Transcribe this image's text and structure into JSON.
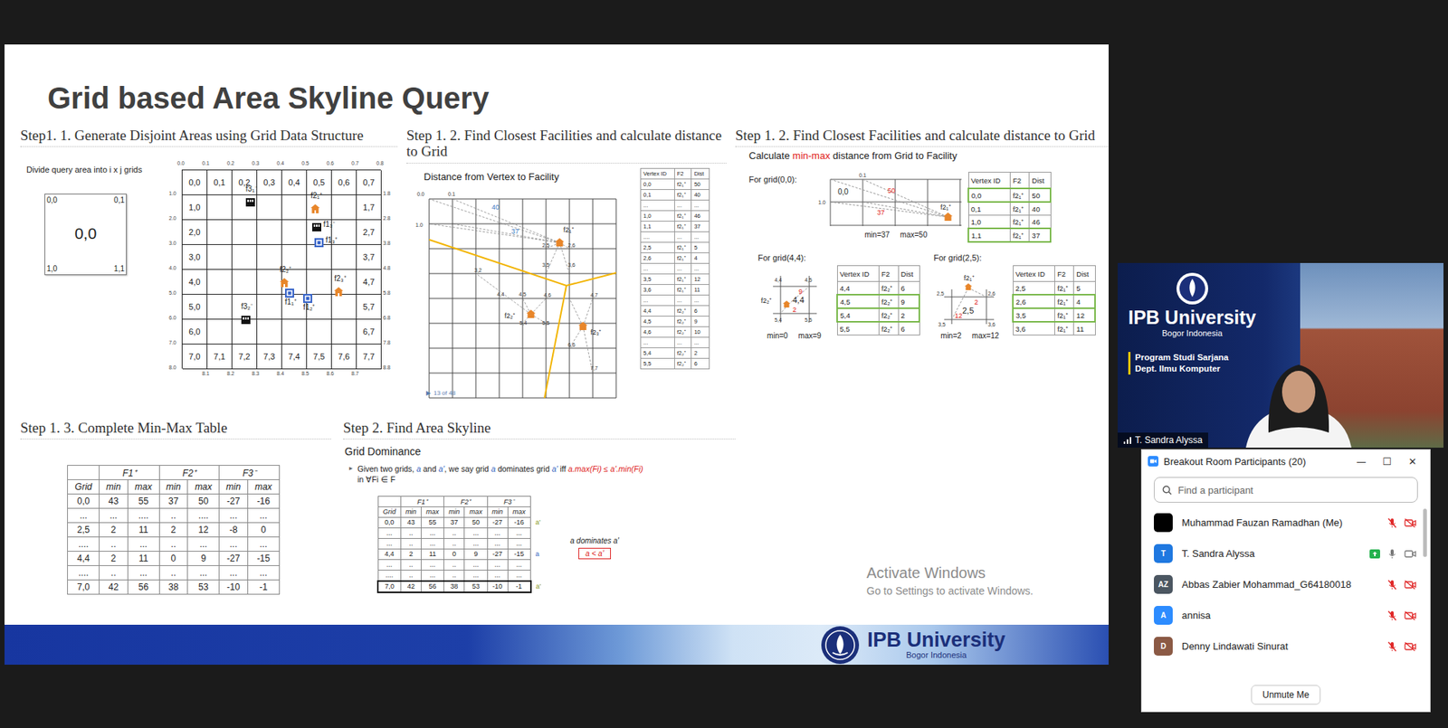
{
  "slide": {
    "title": "Grid based Area Skyline Query",
    "step_generate": {
      "heading": "Step1. 1. Generate Disjoint Areas using Grid Data Structure",
      "caption": "Divide query area into i x j grids",
      "sample_cell": {
        "corners": [
          "0,0",
          "0,1",
          "1,0",
          "1,1"
        ],
        "label": "0,0"
      },
      "grid_rows": [
        [
          "0,0",
          "0,1",
          "0,2",
          "0,3",
          "0,4",
          "0,5",
          "0,6",
          "0,7"
        ],
        [
          "1,0",
          "",
          "",
          "",
          "",
          "",
          "",
          "1,7"
        ],
        [
          "2,0",
          "",
          "",
          "",
          "",
          "",
          "",
          "2,7"
        ],
        [
          "3,0",
          "",
          "",
          "",
          "",
          "",
          "",
          "3,7"
        ],
        [
          "4,0",
          "",
          "",
          "",
          "",
          "",
          "",
          "4,7"
        ],
        [
          "5,0",
          "",
          "",
          "",
          "",
          "",
          "",
          "5,7"
        ],
        [
          "6,0",
          "",
          "",
          "",
          "",
          "",
          "",
          "6,7"
        ],
        [
          "7,0",
          "7,1",
          "7,2",
          "7,3",
          "7,4",
          "7,5",
          "7,6",
          "7,7"
        ]
      ],
      "axis_top": [
        "0.0",
        "0.1",
        "0.2",
        "0.3",
        "0.4",
        "0.5",
        "0.6",
        "0.7",
        "0.8"
      ],
      "axis_left": [
        "1.0",
        "2.0",
        "3.0",
        "4.0",
        "5.0",
        "6.0",
        "7.0",
        "8.0"
      ],
      "axis_right": [
        "1.8",
        "2.8",
        "3.8",
        "4.8",
        "5.8",
        "6.8",
        "7.8",
        "8.8"
      ],
      "axis_bottom": [
        "8.1",
        "8.2",
        "8.3",
        "8.4",
        "8.5",
        "8.6",
        "8.7"
      ],
      "facilities": [
        {
          "label": "f3₁⁻",
          "kind": "hotel"
        },
        {
          "label": "f2₁⁺",
          "kind": "house"
        },
        {
          "label": "f1₃⁻",
          "kind": "hotel"
        },
        {
          "label": "f1₃⁺",
          "kind": "square"
        },
        {
          "label": "f2₂⁺",
          "kind": "house"
        },
        {
          "label": "f2₃⁺",
          "kind": "house"
        },
        {
          "label": "f1₁⁺",
          "kind": "square"
        },
        {
          "label": "f1₂⁺",
          "kind": "square"
        },
        {
          "label": "f3₂⁻",
          "kind": "hotel"
        }
      ]
    },
    "step_distance": {
      "heading": "Step 1. 2. Find Closest Facilities and calculate distance to Grid",
      "subtitle": "Distance from Vertex to Facility",
      "axis_labels": [
        "0.0",
        "0.1",
        "1.0"
      ],
      "distance_labels": [
        "40",
        "37"
      ],
      "vertex_labels": [
        "3,2",
        "2,5",
        "2,6",
        "3,5",
        "3,6",
        "4,4",
        "4,5",
        "4,6",
        "4,7",
        "5,4",
        "5,5",
        "6,6",
        "7,7"
      ],
      "facilities": [
        "f2₁⁺",
        "f2₂⁺",
        "f2₃⁺"
      ],
      "pager_icon": "▶",
      "pager": "13 of 48",
      "table": {
        "columns": [
          "Vertex ID",
          "F2",
          "Dist"
        ],
        "rows": [
          [
            "0,0",
            "f2₁⁺",
            "50"
          ],
          [
            "0,1",
            "f2₁⁺",
            "40"
          ],
          [
            "...",
            "...",
            "..."
          ],
          [
            "1,0",
            "f2₁⁺",
            "46"
          ],
          [
            "1,1",
            "f2₁⁺",
            "37"
          ],
          [
            "....",
            "...",
            "..."
          ],
          [
            "2,5",
            "f2₁⁺",
            "5"
          ],
          [
            "2,6",
            "f2₁⁺",
            "4"
          ],
          [
            "...",
            "...",
            "..."
          ],
          [
            "3,5",
            "f2₁⁺",
            "12"
          ],
          [
            "3,6",
            "f2₁⁺",
            "11"
          ],
          [
            "...",
            "...",
            "..."
          ],
          [
            "4,4",
            "f2₂⁺",
            "6"
          ],
          [
            "4,5",
            "f2₂⁺",
            "9"
          ],
          [
            "4,6",
            "f2₂⁺",
            "10"
          ],
          [
            "...",
            "...",
            "..."
          ],
          [
            "5,4",
            "f2₂⁺",
            "2"
          ],
          [
            "5,5",
            "f2₂⁺",
            "6"
          ]
        ]
      }
    },
    "step_minmax": {
      "heading": "Step 1. 2. Find Closest Facilities and calculate distance to Grid",
      "subtitle_parts": [
        {
          "text": "Calculate ",
          "highlight": false
        },
        {
          "text": "min-max",
          "highlight": true
        },
        {
          "text": " distance from Grid to Facility",
          "highlight": false
        }
      ],
      "columns": [
        "Vertex ID",
        "F2",
        "Dist"
      ],
      "blocks": [
        {
          "kind": "corner",
          "label": "For grid(0,0):",
          "min": "min=37",
          "max": "max=50",
          "diagram": {
            "cell": "0,0",
            "corners": [
              "0.1",
              "1.0"
            ],
            "distances": [
              "50",
              "37"
            ],
            "facility": "f2₁⁺"
          },
          "rows": [
            {
              "cells": [
                "0,0",
                "f2₁⁺",
                "50"
              ],
              "highlighted": true
            },
            {
              "cells": [
                "0,1",
                "f2₁⁺",
                "40"
              ],
              "highlighted": false
            },
            {
              "cells": [
                "1,0",
                "f2₁⁺",
                "46"
              ],
              "highlighted": false
            },
            {
              "cells": [
                "1,1",
                "f2₁⁺",
                "37"
              ],
              "highlighted": true
            }
          ]
        },
        {
          "kind": "interior",
          "label": "For grid(4,4):",
          "min": "min=0",
          "max": "max=9",
          "diagram": {
            "cell": "4,4",
            "corners": [
              "4,4",
              "4,5",
              "5,4",
              "5,5"
            ],
            "distances": [
              "9",
              "2"
            ],
            "facility": "f2₂⁺"
          },
          "rows": [
            {
              "cells": [
                "4,4",
                "f2₂⁺",
                "6"
              ],
              "highlighted": false
            },
            {
              "cells": [
                "4,5",
                "f2₂⁺",
                "9"
              ],
              "highlighted": true
            },
            {
              "cells": [
                "5,4",
                "f2₂⁺",
                "2"
              ],
              "highlighted": true
            },
            {
              "cells": [
                "5,5",
                "f2₂⁺",
                "6"
              ],
              "highlighted": false
            }
          ]
        },
        {
          "kind": "edge",
          "label": "For grid(2,5):",
          "min": "min=2",
          "max": "max=12",
          "diagram": {
            "cell": "2,5",
            "corners": [
              "2,5",
              "2,6",
              "3,5",
              "3,6"
            ],
            "distances": [
              "2",
              "12"
            ],
            "facility": "f2₁⁺"
          },
          "rows": [
            {
              "cells": [
                "2,5",
                "f2₁⁺",
                "5"
              ],
              "highlighted": false
            },
            {
              "cells": [
                "2,6",
                "f2₁⁺",
                "4"
              ],
              "highlighted": true
            },
            {
              "cells": [
                "3,5",
                "f2₁⁺",
                "12"
              ],
              "highlighted": true
            },
            {
              "cells": [
                "3,6",
                "f2₁⁺",
                "11"
              ],
              "highlighted": false
            }
          ]
        }
      ]
    },
    "step_complete": {
      "heading": "Step 1. 3. Complete Min-Max Table",
      "grid_label": "Grid",
      "groups": [
        "F1⁺",
        "F2⁺",
        "F3⁻"
      ],
      "sub": [
        "min",
        "max"
      ],
      "rows": [
        [
          "0,0",
          "43",
          "55",
          "37",
          "50",
          "-27",
          "-16"
        ],
        [
          "...",
          "...",
          "....",
          "..",
          "....",
          "...",
          "..."
        ],
        [
          "2,5",
          "2",
          "11",
          "2",
          "12",
          "-8",
          "0"
        ],
        [
          "....",
          "..",
          "...",
          "..",
          "...",
          "...",
          "..."
        ],
        [
          "4,4",
          "2",
          "11",
          "0",
          "9",
          "-27",
          "-15"
        ],
        [
          "....",
          "..",
          "...",
          "..",
          "...",
          "...",
          "..."
        ],
        [
          "7,0",
          "42",
          "56",
          "38",
          "53",
          "-10",
          "-1"
        ]
      ]
    },
    "step_skyline": {
      "heading": "Step 2. Find Area Skyline",
      "subheading": "Grid Dominance",
      "bullet": "▸",
      "segments": [
        {
          "text": "Given two grids, ",
          "kind": "plain"
        },
        {
          "text": "a",
          "kind": "var"
        },
        {
          "text": " and ",
          "kind": "plain"
        },
        {
          "text": "a'",
          "kind": "var"
        },
        {
          "text": ", we say grid ",
          "kind": "plain"
        },
        {
          "text": "a",
          "kind": "var"
        },
        {
          "text": " dominates grid ",
          "kind": "plain"
        },
        {
          "text": "a'",
          "kind": "var"
        },
        {
          "text": " iff ",
          "kind": "plain"
        },
        {
          "text": "a.max(Fi) ≤",
          "kind": "red"
        },
        {
          "text": " ",
          "kind": "plain"
        },
        {
          "text": "a'.min(Fi)",
          "kind": "red"
        },
        {
          "text": " in ∀Fi ∈ F",
          "kind": "plain"
        }
      ],
      "grid_label": "Grid",
      "groups": [
        "F1⁺",
        "F2⁺",
        "F3⁻"
      ],
      "sub": [
        "min",
        "max"
      ],
      "rows": [
        {
          "cells": [
            "0,0",
            "43",
            "55",
            "37",
            "50",
            "-27",
            "-16"
          ],
          "tag": "a'",
          "tag_color": "#8a9a1e",
          "boxed": false
        },
        {
          "cells": [
            "...",
            "..",
            "...",
            "..",
            "...",
            "...",
            "..."
          ],
          "tag": "",
          "tag_color": "#8a9a1e",
          "boxed": false
        },
        {
          "cells": [
            "...",
            "..",
            "...",
            "..",
            "...",
            "...",
            "..."
          ],
          "tag": "",
          "tag_color": "#8a9a1e",
          "boxed": false
        },
        {
          "cells": [
            "4,4",
            "2",
            "11",
            "0",
            "9",
            "-27",
            "-15"
          ],
          "tag": "a",
          "tag_color": "#3565c0",
          "boxed": false
        },
        {
          "cells": [
            "...",
            "..",
            "...",
            "..",
            "...",
            "...",
            "..."
          ],
          "tag": "",
          "tag_color": "#8a9a1e",
          "boxed": false
        },
        {
          "cells": [
            "....",
            "..",
            "...",
            "..",
            "...",
            "...",
            "..."
          ],
          "tag": "",
          "tag_color": "#8a9a1e",
          "boxed": false
        },
        {
          "cells": [
            "7,0",
            "42",
            "56",
            "38",
            "53",
            "-10",
            "-1"
          ],
          "tag": "a'",
          "tag_color": "#8a9a1e",
          "boxed": true
        }
      ],
      "note": "a dominates a'",
      "relation": "a < a'"
    },
    "watermark": {
      "title": "Activate Windows",
      "subtitle": "Go to Settings to activate Windows."
    },
    "footer": {
      "brand": "IPB University",
      "tagline": "Bogor Indonesia"
    }
  },
  "video": {
    "brand": "IPB University",
    "tagline": "Bogor Indonesia",
    "program": [
      "Program Studi Sarjana",
      "Dept. Ilmu Komputer"
    ],
    "speaker": "T. Sandra Alyssa"
  },
  "participants": {
    "title": "Breakout Room Participants (20)",
    "controls": [
      "—",
      "☐",
      "✕"
    ],
    "search": {
      "placeholder": "Find a participant"
    },
    "people": [
      {
        "name": "Muhammad Fauzan Ramadhan (Me)",
        "initials": "",
        "color": "#000000",
        "mic_on": false,
        "video_on": false,
        "sharing": false
      },
      {
        "name": "T. Sandra Alyssa",
        "initials": "T",
        "color": "#1f78e0",
        "mic_on": true,
        "video_on": true,
        "sharing": true
      },
      {
        "name": "Abbas Zabier Mohammad_G64180018",
        "initials": "AZ",
        "color": "#4b5661",
        "mic_on": false,
        "video_on": false,
        "sharing": false
      },
      {
        "name": "annisa",
        "initials": "A",
        "color": "#2d8cff",
        "mic_on": false,
        "video_on": false,
        "sharing": false
      },
      {
        "name": "Denny Lindawati Sinurat",
        "initials": "D",
        "color": "#8b5a45",
        "mic_on": false,
        "video_on": false,
        "sharing": false
      }
    ],
    "footer_button": "Unmute Me"
  }
}
